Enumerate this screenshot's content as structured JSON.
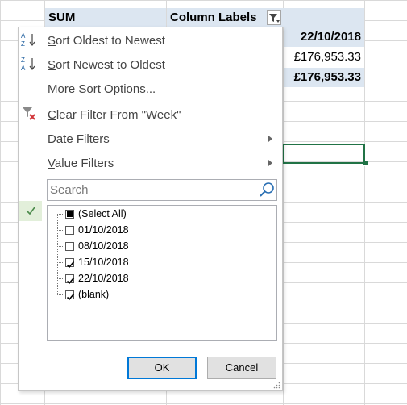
{
  "sheet": {
    "header_sum": "SUM",
    "header_column_labels": "Column Labels",
    "col_date_header": "22/10/2018",
    "row1_value": "£176,953.33",
    "row2_value": "£176,953.33"
  },
  "menu": {
    "sort_oldest": "ort Oldest to Newest",
    "sort_oldest_ul": "S",
    "sort_newest": "ort Newest to Oldest",
    "sort_newest_ul": "S",
    "more_sort": "ore Sort Options...",
    "more_sort_ul": "M",
    "clear_filter": "lear Filter From \"Week\"",
    "clear_filter_ul": "C",
    "date_filters": "ate Filters",
    "date_filters_ul": "D",
    "value_filters": "alue Filters",
    "value_filters_ul": "V",
    "search_placeholder": "Search",
    "items": [
      {
        "label": "(Select All)",
        "state": "partial"
      },
      {
        "label": "01/10/2018",
        "state": "unchecked"
      },
      {
        "label": "08/10/2018",
        "state": "unchecked"
      },
      {
        "label": "15/10/2018",
        "state": "checked"
      },
      {
        "label": "22/10/2018",
        "state": "checked"
      },
      {
        "label": "(blank)",
        "state": "checked"
      }
    ],
    "ok_label": "OK",
    "cancel_label": "Cancel"
  }
}
